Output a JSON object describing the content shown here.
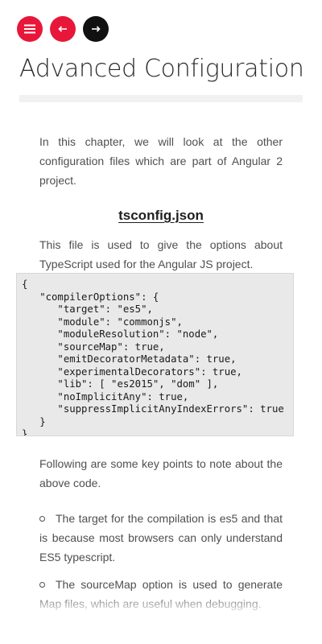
{
  "toolbar": {
    "menu_icon": "menu-icon",
    "back_icon": "arrow-left-icon",
    "forward_icon": "arrow-right-icon",
    "accent_color": "#e8173a",
    "dark_color": "#111111"
  },
  "page": {
    "title": "Advanced Configuration",
    "intro": "In this chapter, we will look at the other configuration files which are part of Angular 2 project.",
    "section_heading": "tsconfig.json",
    "section_intro": "This file is used to give the options about TypeScript used for the Angular JS project."
  },
  "code": {
    "lines": [
      "{",
      "   \"compilerOptions\": {",
      "      \"target\": \"es5\",",
      "      \"module\": \"commonjs\",",
      "      \"moduleResolution\": \"node\",",
      "      \"sourceMap\": true,",
      "      \"emitDecoratorMetadata\": true,",
      "      \"experimentalDecorators\": true,",
      "      \"lib\": [ \"es2015\", \"dom\" ],",
      "      \"noImplicitAny\": true,",
      "      \"suppressImplicitAnyIndexErrors\": true",
      "   }",
      "}"
    ]
  },
  "notes": {
    "lead": "Following are some key points to note about the above code.",
    "points": [
      "The target for the compilation is es5 and that is because most browsers can only understand ES5 typescript.",
      "The sourceMap option is used to generate Map files, which are useful when debugging."
    ]
  }
}
